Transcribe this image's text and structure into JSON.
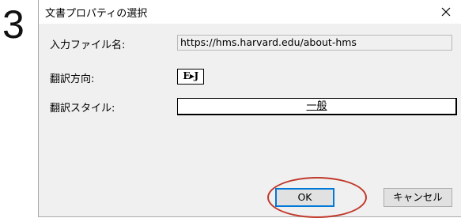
{
  "step": {
    "number": "3"
  },
  "dialog": {
    "title": "文書プロパティの選択",
    "close_glyph": "✕",
    "fields": {
      "filename_label": "入力ファイル名:",
      "filename_value": "https://hms.harvard.edu/about-hms",
      "direction_label": "翻訳方向:",
      "direction_value": "E▸J",
      "style_label": "翻訳スタイル:",
      "style_value": "一般"
    },
    "buttons": {
      "ok_label": "OK",
      "cancel_label": "キャンセル"
    }
  },
  "colors": {
    "annotation_circle": "#c0392b",
    "default_button_border": "#0078d7",
    "dialog_background": "#f0f0f0"
  }
}
